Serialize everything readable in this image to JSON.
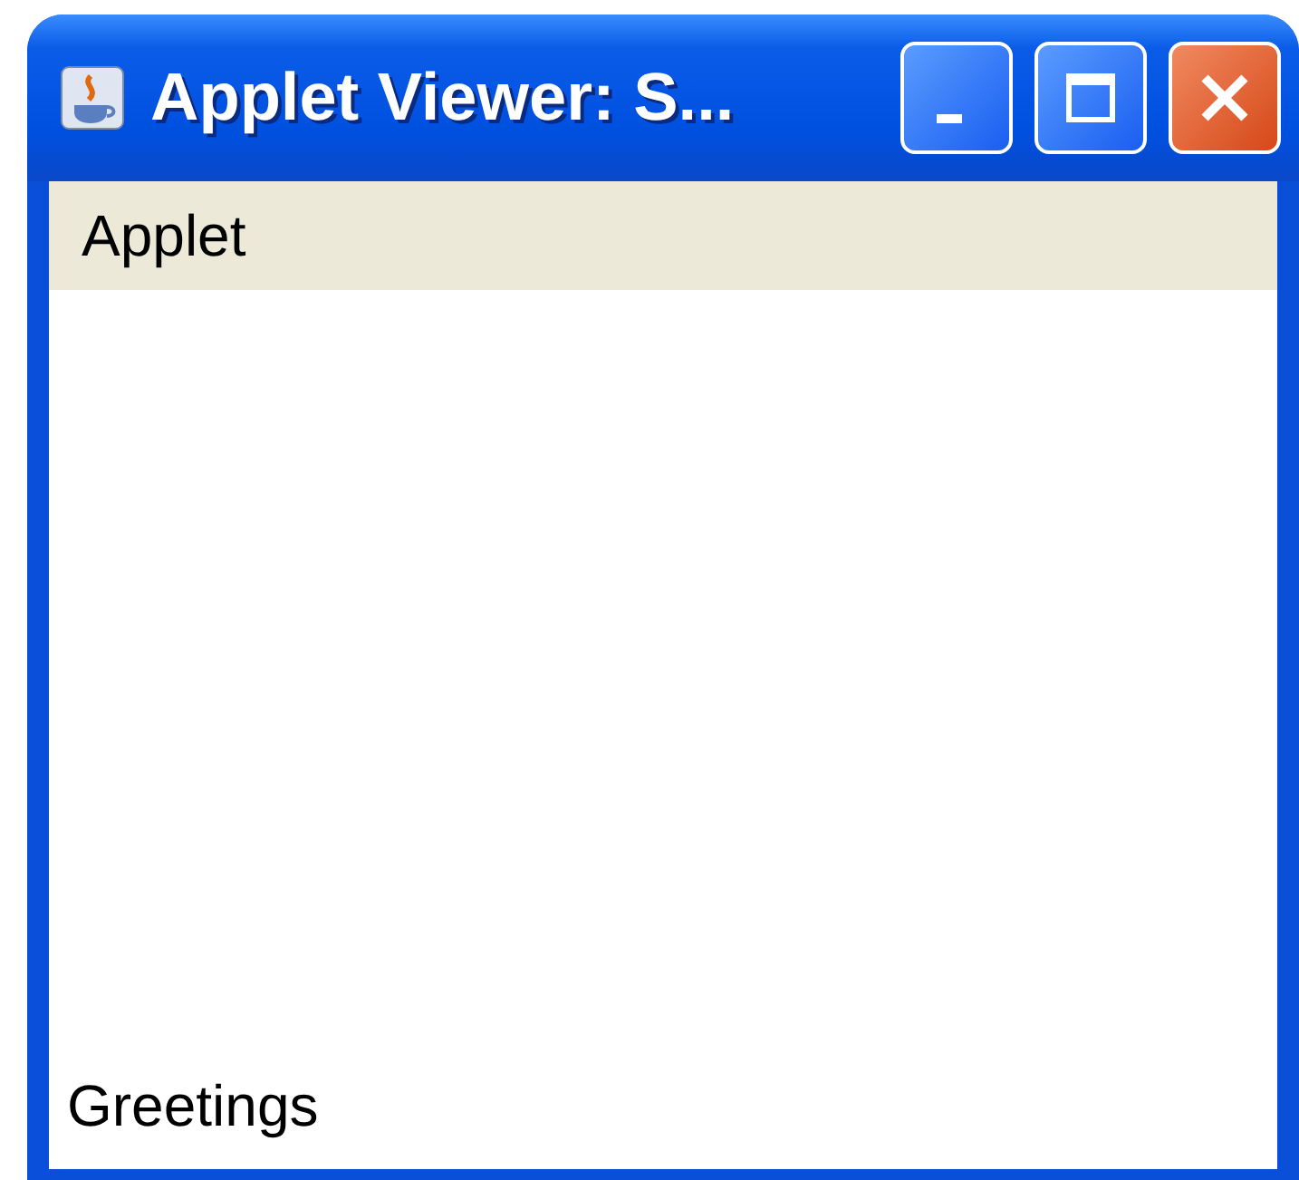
{
  "window": {
    "title": "Applet Viewer: S..."
  },
  "menu_bar": {
    "items": [
      {
        "label": "Applet"
      }
    ]
  },
  "applet": {
    "status_text": "Greetings"
  }
}
